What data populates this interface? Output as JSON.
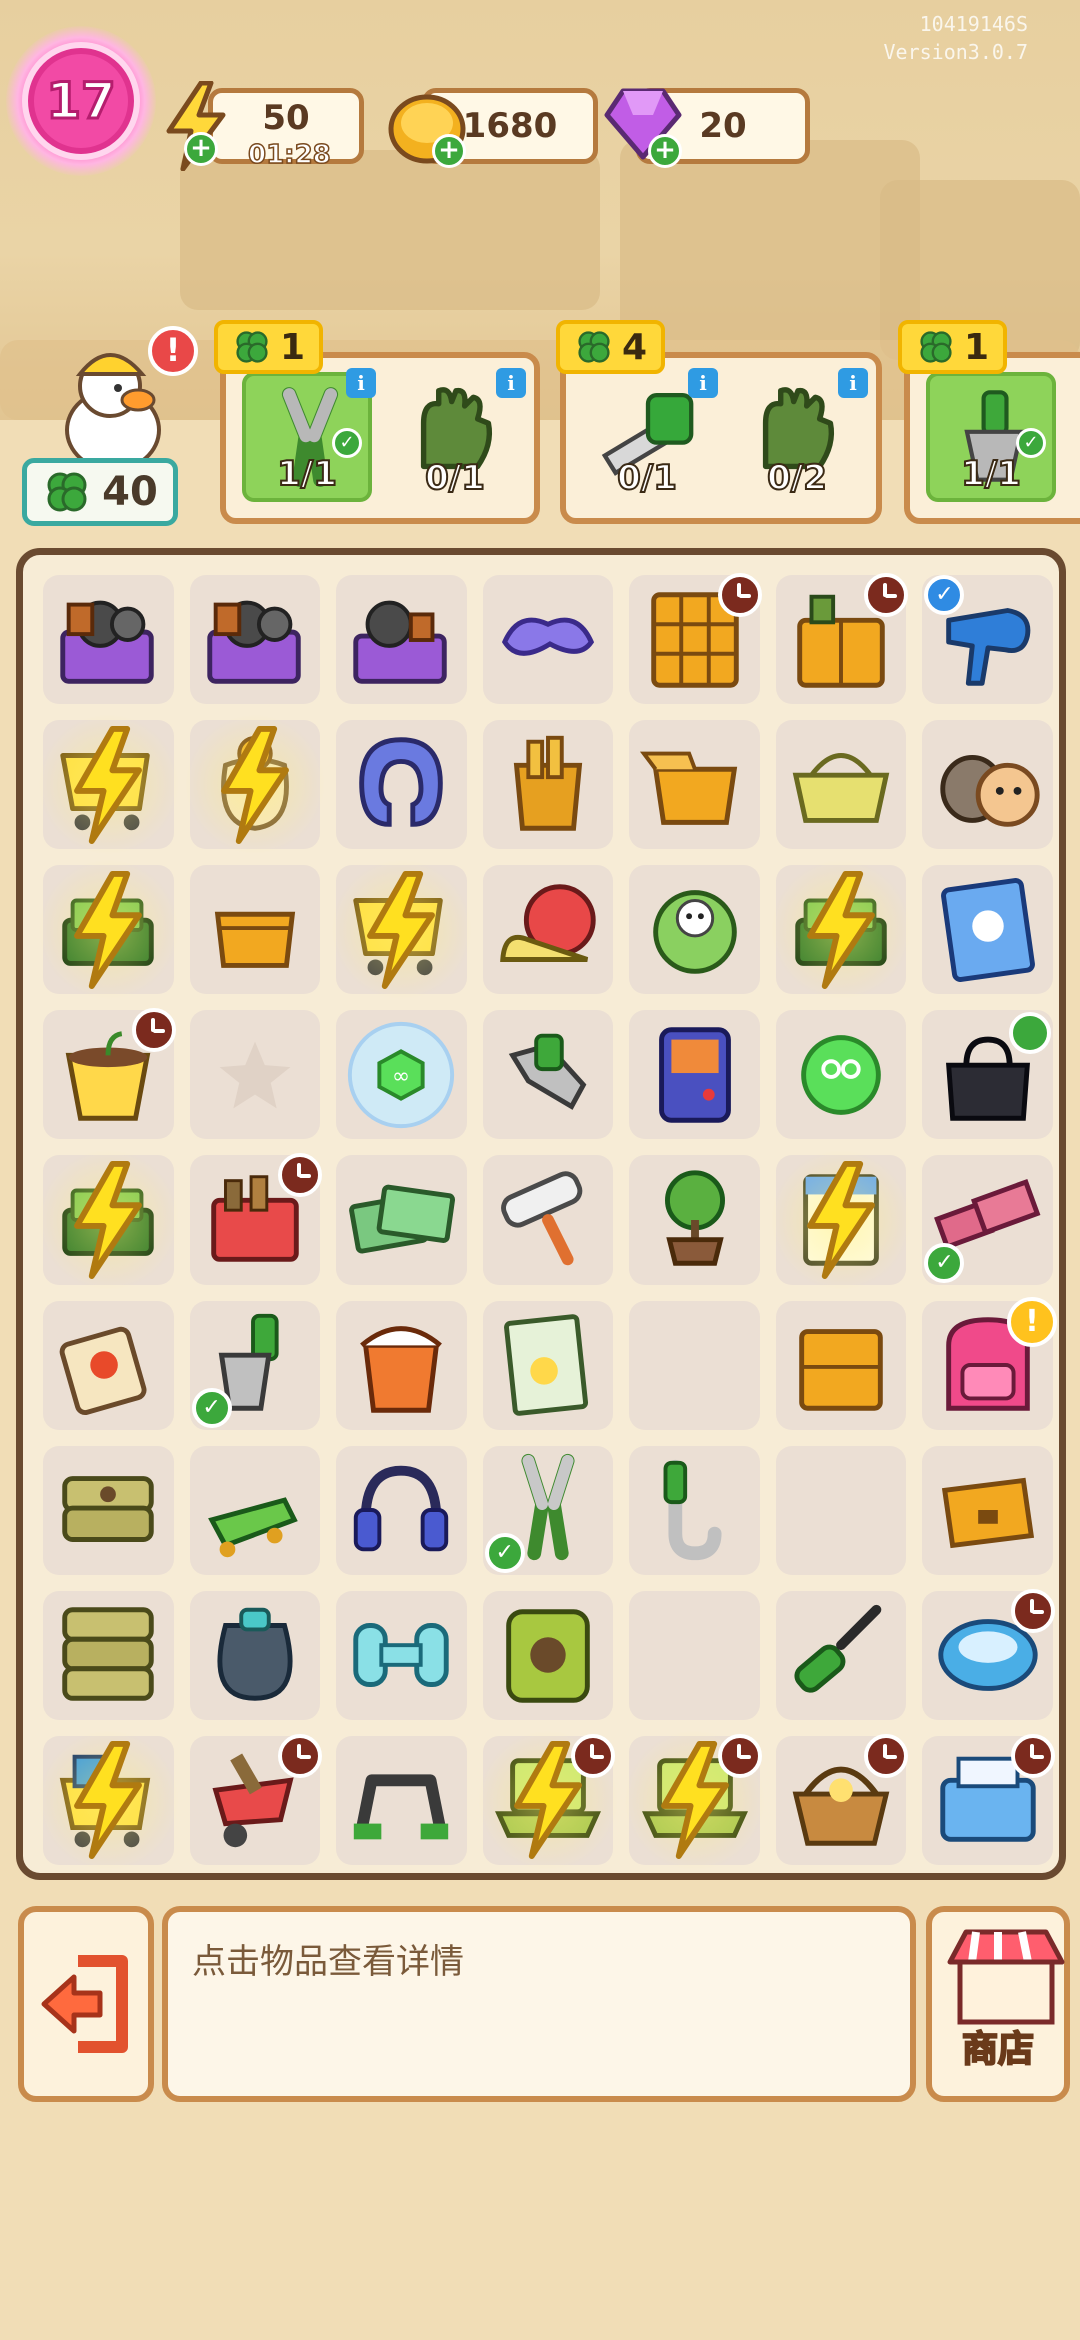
{
  "header": {
    "id_text": "10419146S",
    "version_text": "Version3.0.7",
    "level": "17",
    "energy": {
      "value": "50",
      "timer": "01:28"
    },
    "coins": {
      "value": "1680"
    },
    "gems": {
      "value": "20"
    }
  },
  "worker": {
    "clover_count": "40",
    "alert": "!"
  },
  "orders": [
    {
      "reward": "1",
      "items": [
        {
          "name": "pliers",
          "count": "1/1",
          "done": true
        },
        {
          "name": "gloves",
          "count": "0/1",
          "done": false
        }
      ]
    },
    {
      "reward": "4",
      "items": [
        {
          "name": "saw-drill",
          "count": "0/1",
          "done": false
        },
        {
          "name": "gloves",
          "count": "0/2",
          "done": false
        }
      ]
    },
    {
      "reward": "1",
      "items": [
        {
          "name": "wrench-tool",
          "count": "1/1",
          "done": true
        }
      ]
    }
  ],
  "board": {
    "cells": [
      {
        "item": "tool-box-full"
      },
      {
        "item": "tool-box-full"
      },
      {
        "item": "tool-box"
      },
      {
        "item": "goggles"
      },
      {
        "item": "cabinet",
        "timer": true
      },
      {
        "item": "cabinet-small",
        "timer": true
      },
      {
        "item": "hair-dryer",
        "check": "tl"
      },
      {
        "item": "cart-yellow",
        "bolt": true
      },
      {
        "item": "coin-sack",
        "bolt": true
      },
      {
        "item": "neck-pillow"
      },
      {
        "item": "paper-bag"
      },
      {
        "item": "box-open"
      },
      {
        "item": "basket-yellow"
      },
      {
        "item": "hamsters"
      },
      {
        "item": "cash-pile",
        "bolt": true
      },
      {
        "item": "box-small"
      },
      {
        "item": "cart-yellow",
        "bolt": true
      },
      {
        "item": "snail"
      },
      {
        "item": "cabbage-duck"
      },
      {
        "item": "cash-pile",
        "bolt": true
      },
      {
        "item": "book-duck"
      },
      {
        "item": "plant-pot",
        "timer": true
      },
      {
        "item": "empty-star"
      },
      {
        "item": "bubble"
      },
      {
        "item": "wrench"
      },
      {
        "item": "game-console"
      },
      {
        "item": "scissors-orb"
      },
      {
        "item": "bag-black",
        "lock": true
      },
      {
        "item": "cash-pile",
        "bolt": true
      },
      {
        "item": "red-cooler",
        "timer": true
      },
      {
        "item": "money-stack"
      },
      {
        "item": "paint-roller"
      },
      {
        "item": "bonsai"
      },
      {
        "item": "calendar",
        "bolt": true
      },
      {
        "item": "bricks",
        "check": "bl"
      },
      {
        "item": "paint-can"
      },
      {
        "item": "wrench-tool",
        "check": "bl"
      },
      {
        "item": "trash-bin"
      },
      {
        "item": "newspaper"
      },
      {
        "item": "empty"
      },
      {
        "item": "drawer-small"
      },
      {
        "item": "pink-backpack",
        "alert": true
      },
      {
        "item": "sacks"
      },
      {
        "item": "green-mower"
      },
      {
        "item": "headphones"
      },
      {
        "item": "pliers",
        "check": "bl"
      },
      {
        "item": "crowbar"
      },
      {
        "item": "empty"
      },
      {
        "item": "box-drawer"
      },
      {
        "item": "sacks-stack"
      },
      {
        "item": "dark-sack"
      },
      {
        "item": "dumbbell"
      },
      {
        "item": "green-sack"
      },
      {
        "item": "empty"
      },
      {
        "item": "screwdriver"
      },
      {
        "item": "robot-vacuum",
        "timer": true
      },
      {
        "item": "cart-blue",
        "bolt": true
      },
      {
        "item": "wheelbarrow",
        "timer": true
      },
      {
        "item": "green-clamp"
      },
      {
        "item": "laptop",
        "bolt": true,
        "timer": true
      },
      {
        "item": "laptop",
        "bolt": true,
        "timer": true
      },
      {
        "item": "flower-basket",
        "timer": true
      },
      {
        "item": "printer",
        "timer": true
      }
    ]
  },
  "bottom": {
    "detail_hint": "点击物品查看详情",
    "shop_label": "商店"
  },
  "colors": {
    "accent": "#c98b4c",
    "board_border": "#6a4a30",
    "energy": "#ffd83a",
    "gem": "#b84fe0"
  }
}
